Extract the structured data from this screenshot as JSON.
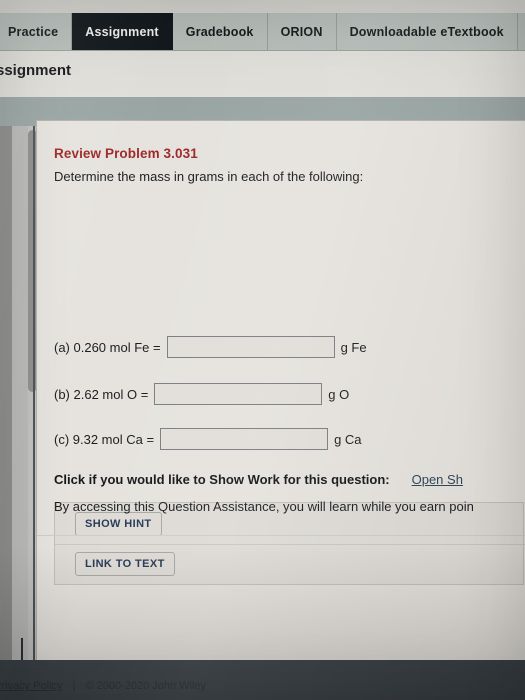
{
  "tabs": [
    {
      "label": "Practice",
      "active": false
    },
    {
      "label": "Assignment",
      "active": true
    },
    {
      "label": "Gradebook",
      "active": false
    },
    {
      "label": "ORION",
      "active": false
    },
    {
      "label": "Downloadable eTextbook",
      "active": false
    }
  ],
  "page": {
    "title": "ssignment"
  },
  "question": {
    "number": "Review Problem 3.031",
    "prompt": "Determine the mass in grams in each of the following:",
    "answers": [
      {
        "label": "(a) 0.260 mol Fe =",
        "value": "",
        "placeholder": "",
        "unit": "g Fe"
      },
      {
        "label": "(b) 2.62 mol O =",
        "value": "",
        "placeholder": "",
        "unit": "g O"
      },
      {
        "label": "(c) 9.32 mol Ca =",
        "value": "",
        "placeholder": "",
        "unit": "g Ca"
      }
    ],
    "show_work_label": "Click if you would like to Show Work for this question:",
    "show_work_link": "Open Sh"
  },
  "assistance": {
    "show_hint": "SHOW HINT",
    "link_to_text": "LINK TO TEXT",
    "note": "By accessing this Question Assistance, you will learn while you earn poin"
  },
  "footer": {
    "privacy": "Privacy Policy",
    "separator": "|",
    "copyright": "© 2000-2020 John Wiley"
  },
  "colors": {
    "active_tab_bg": "#12181d",
    "tab_bg": "#b9c0bc",
    "question_title": "#9e2a2b",
    "link": "#2f4456",
    "button_text": "#253a55",
    "band": "#9aa6a4"
  }
}
